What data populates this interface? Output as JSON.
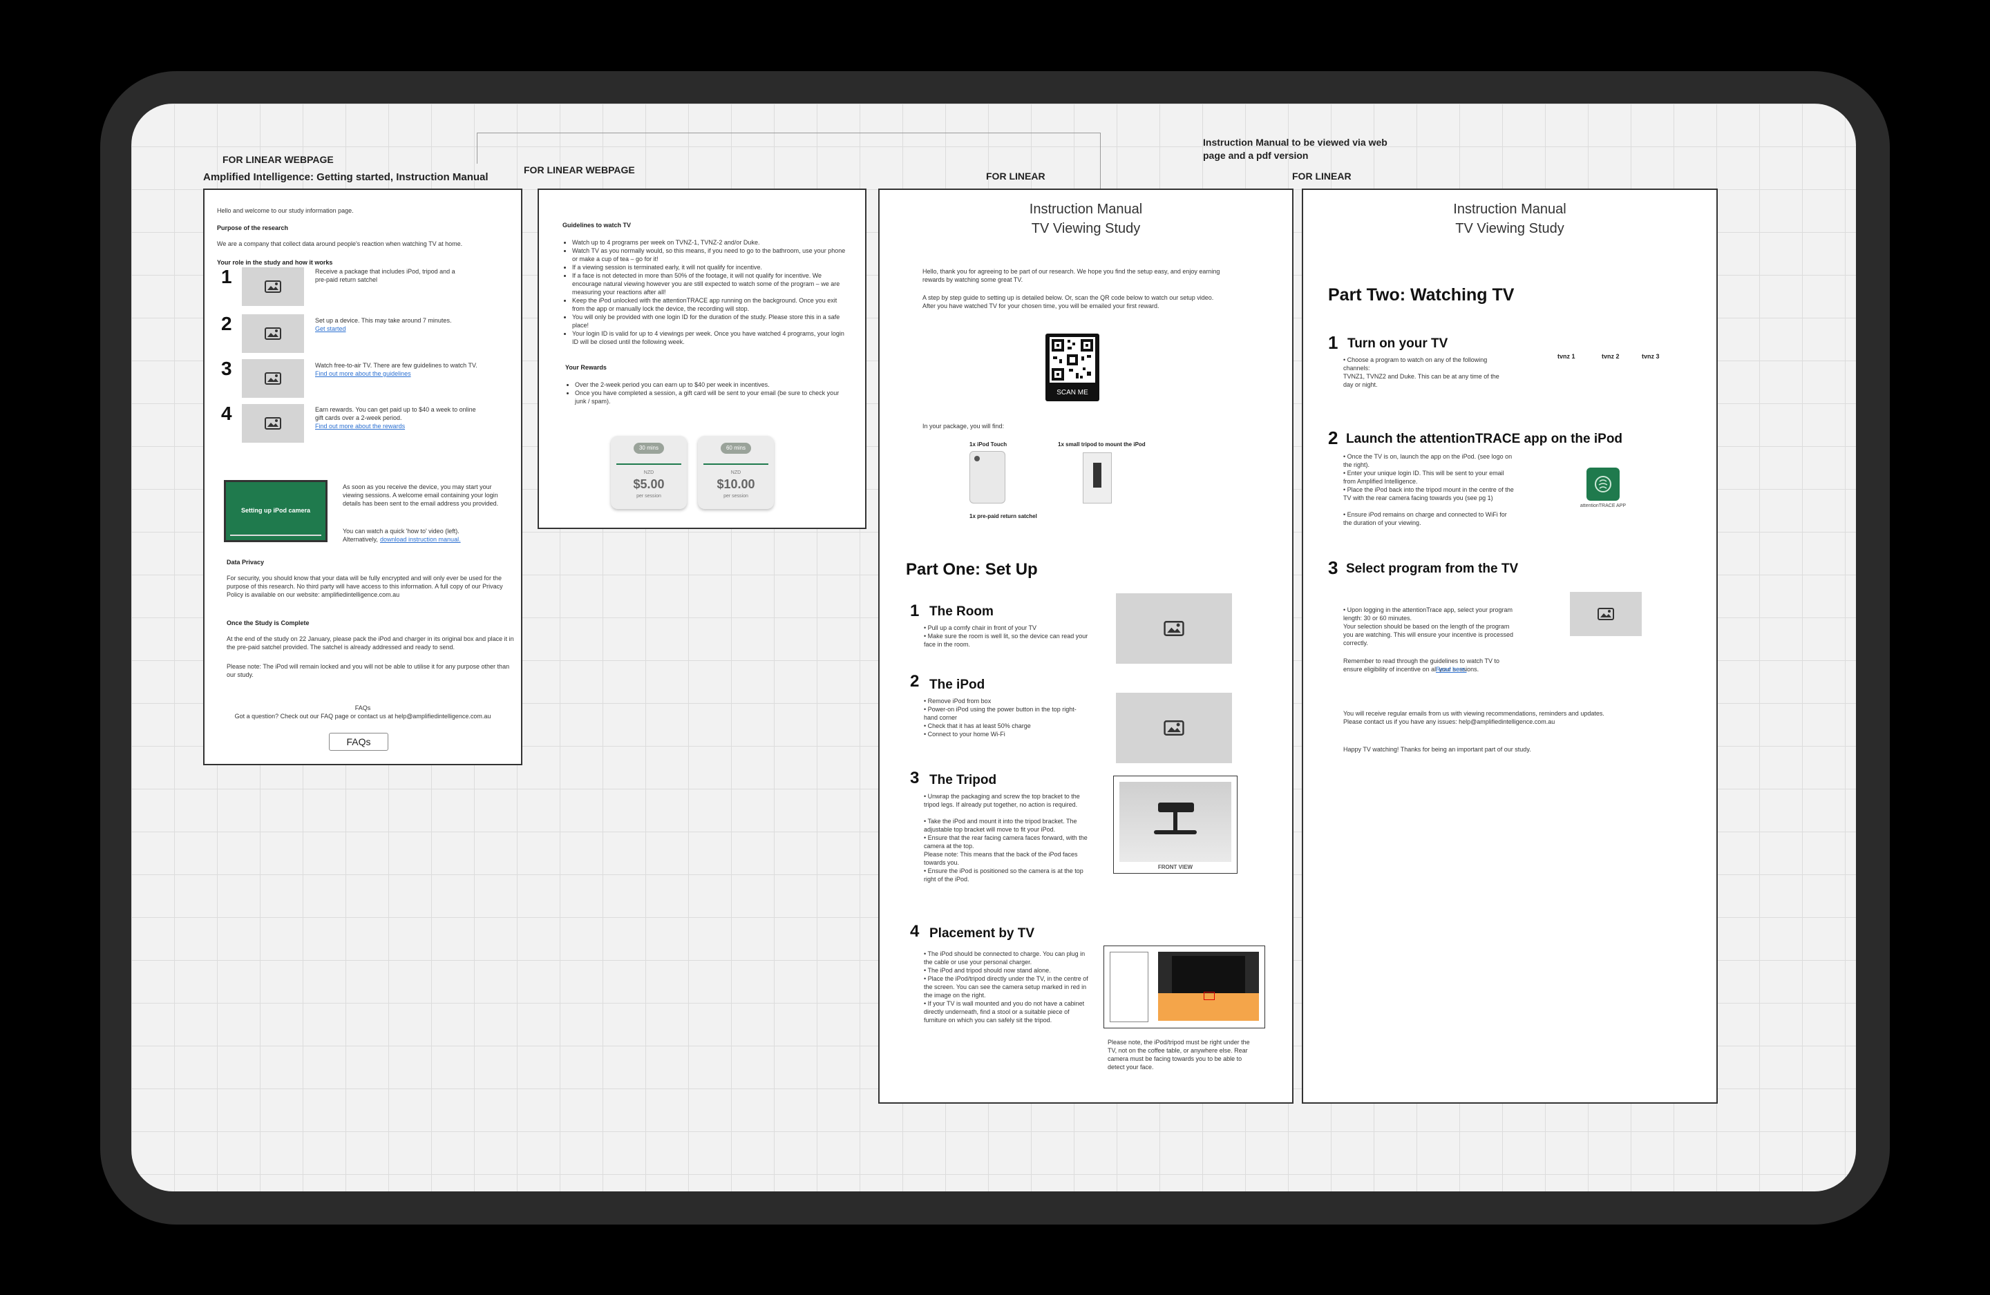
{
  "labels": {
    "linear_webpage_1": "FOR LINEAR WEBPAGE",
    "main_title": "Amplified Intelligence: Getting started, Instruction Manual",
    "linear_webpage_2": "FOR LINEAR WEBPAGE",
    "linear_1": "FOR LINEAR",
    "manual_note": "Instruction Manual to be viewed via web page and a pdf version",
    "linear_2": "FOR LINEAR"
  },
  "page1": {
    "intro": "Hello and welcome to our study information page.",
    "purpose_heading": "Purpose of the research",
    "purpose_text": "We are a company that collect data around people's reaction when watching TV at home.",
    "role_heading": "Your role in the study and how it works",
    "steps": [
      {
        "num": "1",
        "text": "Receive a package that includes iPod, tripod and a pre-paid return satchel",
        "link": ""
      },
      {
        "num": "2",
        "text": "Set up a device. This may take around 7 minutes.",
        "link": "Get started"
      },
      {
        "num": "3",
        "text": "Watch free-to-air TV. There are few guidelines to watch TV.",
        "link": "Find out more about the guidelines"
      },
      {
        "num": "4",
        "text": "Earn rewards. You can get paid up to $40 a week to online gift cards over a 2-week period.",
        "link": "Find out more about the rewards"
      }
    ],
    "video_label": "Setting up iPod camera",
    "video_text1": "As soon as you receive the device, you may start your viewing sessions. A welcome email containing your login details has been sent to the email address you provided.",
    "video_text2": "You can watch a quick 'how to' video (left). Alternatively,",
    "video_link": "download instruction manual.",
    "privacy_heading": "Data Privacy",
    "privacy_text": "For security, you should know that your data will be fully encrypted and will only ever be used for the purpose of this research. No third party will have access to this information. A full copy of our Privacy Policy is available on our website: amplifiedintelligence.com.au",
    "complete_heading": "Once the Study is Complete",
    "complete_text1": "At the end of the study on 22 January, please pack the iPod and charger in its original box and place it in the pre-paid satchel provided. The satchel is already addressed and ready to send.",
    "complete_text2": "Please note: The iPod will remain locked and you will not be able to utilise it for any purpose other than our study.",
    "faqs_small": "FAQs",
    "faqs_text": "Got a question? Check out our FAQ page or contact us at help@amplifiedintelligence.com.au",
    "faqs_button": "FAQs"
  },
  "page2": {
    "guidelines_heading": "Guidelines to watch TV",
    "guidelines": [
      "Watch up to 4 programs per week on TVNZ-1, TVNZ-2 and/or Duke.",
      "Watch TV as you normally would, so this means, if you need to go to the bathroom, use your phone or make a cup of tea – go for it!",
      "If a viewing session is terminated early, it will not qualify for incentive.",
      "If a face is not detected in more than 50% of the footage, it will not qualify for incentive. We encourage natural viewing however you are still expected to watch some of the program – we are measuring your reactions after all!",
      "Keep the iPod unlocked with the attentionTRACE app running on the background. Once you exit from the app or manually lock the device, the recording will stop.",
      "You will only be provided with one login ID for the duration of the study. Please store this in a safe place!",
      "Your login ID is valid for up to 4 viewings per week. Once you have watched 4 programs, your login ID will be closed until the following week."
    ],
    "rewards_heading": "Your Rewards",
    "rewards": [
      "Over the 2-week period you can earn up to $40 per week in incentives.",
      "Once you have completed a session, a gift card will be sent to your email (be sure to check your junk / spam)."
    ],
    "cards": [
      {
        "badge": "30 mins",
        "small": "NZD",
        "amount": "$5.00",
        "sub": "per session"
      },
      {
        "badge": "60 mins",
        "small": "NZD",
        "amount": "$10.00",
        "sub": "per session"
      }
    ]
  },
  "page3": {
    "title_line1": "Instruction Manual",
    "title_line2": "TV Viewing Study",
    "intro1": "Hello, thank you for agreeing to be part of our research. We hope you find the setup easy, and enjoy earning rewards by watching some great TV.",
    "intro2": "A step by step guide to setting up is detailed below. Or, scan the QR code below to watch our setup video. After you have watched TV for your chosen time, you will be emailed your first reward.",
    "scan_me": "SCAN ME",
    "package_intro": "In your package, you will find:",
    "package_items": [
      "1x iPod Touch",
      "1x small tripod to mount the iPod",
      "1x pre-paid return satchel"
    ],
    "part_title": "Part One: Set Up",
    "sections": [
      {
        "num": "1",
        "title": "The Room",
        "lines": [
          "• Pull up a comfy chair in front of your TV",
          "• Make sure the room is well lit, so the device can read your face in the room."
        ]
      },
      {
        "num": "2",
        "title": "The iPod",
        "lines": [
          "• Remove iPod from box",
          "• Power-on iPod using the power button in the top right-hand corner",
          "• Check that it has at least 50% charge",
          "• Connect to your home Wi-Fi"
        ]
      },
      {
        "num": "3",
        "title": "The Tripod",
        "lines": [
          "• Unwrap the packaging and screw the top bracket to the tripod legs. If already put together, no action is required.",
          "• Take the iPod and mount it into the tripod bracket. The adjustable top bracket will move to fit your iPod.",
          "• Ensure that the rear facing camera faces forward, with the camera at the top.",
          "Please note: This means that the back of the iPod faces towards you.",
          "• Ensure the iPod is positioned so the camera is at the top right of the iPod."
        ]
      },
      {
        "num": "4",
        "title": "Placement by TV",
        "lines": [
          "• The iPod should be connected to charge. You can plug in the cable or use your personal charger.",
          "• The iPod and tripod should now stand alone.",
          "• Place the iPod/tripod directly under the TV, in the centre of the screen. You can see the camera setup marked in red in the image on the right.",
          "• If your TV is wall mounted and you do not have a cabinet directly underneath, find a stool or a suitable piece of furniture on which you can safely sit the tripod."
        ]
      }
    ],
    "tripod_caption": "FRONT VIEW",
    "placement_note": "Please note, the iPod/tripod must be right under the TV, not on the coffee table, or anywhere else. Rear camera must be facing towards you to be able to detect your face."
  },
  "page4": {
    "title_line1": "Instruction Manual",
    "title_line2": "TV Viewing Study",
    "part_title": "Part Two: Watching TV",
    "sections": [
      {
        "num": "1",
        "title": "Turn on your TV",
        "lines": [
          "• Choose a program to watch on any of the following channels:",
          "TVNZ1, TVNZ2 and Duke. This can be at any time of the day or night."
        ]
      },
      {
        "num": "2",
        "title": "Launch the attentionTRACE app on the iPod",
        "lines": [
          "• Once the TV is on, launch the app on the iPod. (see logo on the right).",
          "• Enter your unique login ID. This will be sent to your email from Amplified Intelligence.",
          "• Place the iPod back into the tripod mount in the centre of the TV with the rear camera facing towards you (see pg 1)",
          "• Ensure iPod remains on charge and connected to WiFi for the duration of your viewing."
        ]
      },
      {
        "num": "3",
        "title": "Select program from the TV",
        "lines": [
          "• Upon logging in the attentionTrace app, select your program length: 30 or 60 minutes.",
          "Your selection should be based on the length of the program you are watching. This will ensure your incentive is processed correctly.",
          "",
          "Remember to read through the guidelines to watch TV to ensure eligibility of incentive on all your sessions."
        ]
      }
    ],
    "read_here": "Read here.",
    "channels": [
      "tvnz 1",
      "tvnz 2",
      "tvnz 3"
    ],
    "app_label": "attentionTRACE APP",
    "emails_text": "You will receive regular emails from us with viewing recommendations, reminders and updates. Please contact us if you have any issues: help@amplifiedintelligence.com.au",
    "happy_text": "Happy TV watching!  Thanks for being an important part of our study."
  }
}
